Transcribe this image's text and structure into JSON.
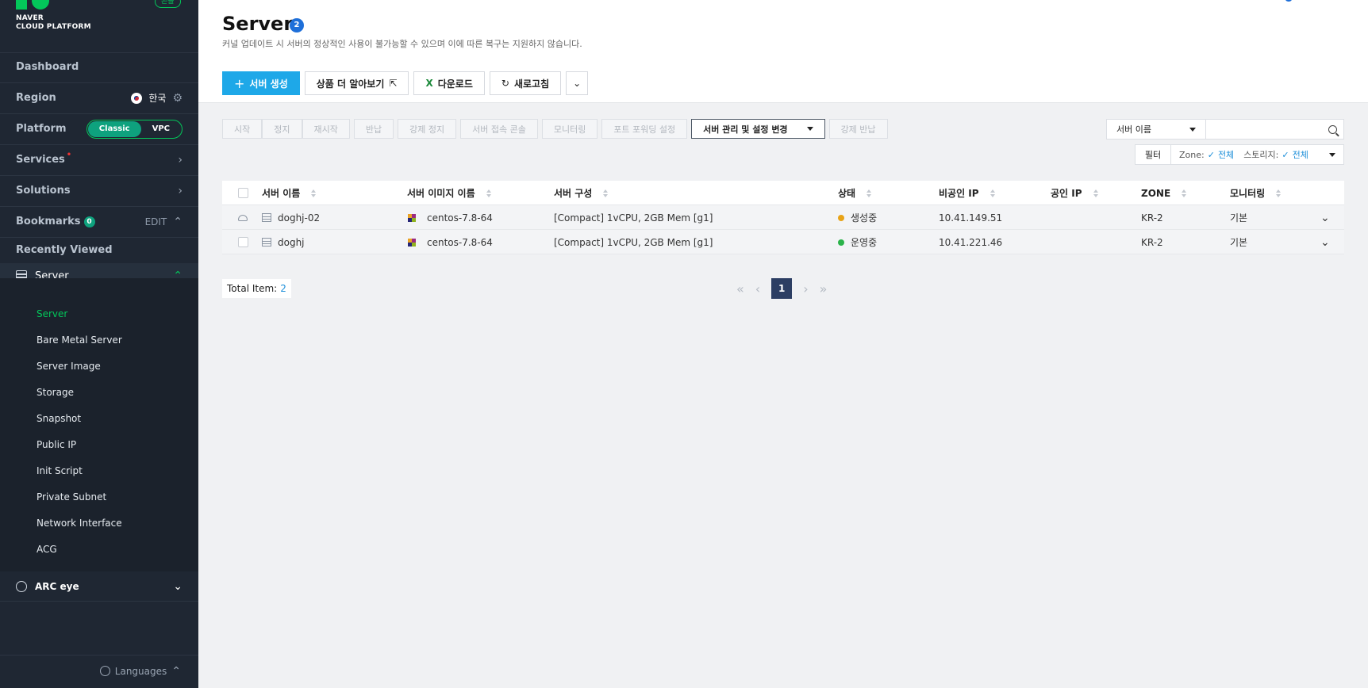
{
  "brand": {
    "name_line1": "NAVER",
    "name_line2": "CLOUD PLATFORM",
    "console_badge": "콘솔"
  },
  "sidebar": {
    "dashboard": "Dashboard",
    "region_label": "Region",
    "region_value": "한국",
    "platform_label": "Platform",
    "platform_options": [
      "Classic",
      "VPC"
    ],
    "platform_selected": "Classic",
    "services": "Services",
    "solutions": "Solutions",
    "bookmarks": "Bookmarks",
    "bookmarks_count": "0",
    "bookmarks_edit": "EDIT",
    "recently_viewed": "Recently Viewed",
    "server_group": "Server",
    "sub_items": [
      "Server",
      "Bare Metal Server",
      "Server Image",
      "Storage",
      "Snapshot",
      "Public IP",
      "Init Script",
      "Private Subnet",
      "Network Interface",
      "ACG"
    ],
    "active_sub_item": "Server",
    "arc_eye": "ARC eye",
    "languages": "Languages"
  },
  "page": {
    "title": "Server",
    "count_badge": "2",
    "subtitle": "커널 업데이트 시 서버의 정상적인 사용이 불가능할 수 있으며 이에 따른 복구는 지원하지 않습니다."
  },
  "actions": {
    "create": "서버 생성",
    "learn_more": "상품 더 알아보기",
    "download": "다운로드",
    "refresh": "새로고침"
  },
  "toolbar": {
    "buttons": [
      "시작",
      "정지",
      "재시작",
      "반납",
      "강제 정지",
      "서버 접속 콘솔",
      "모니터링",
      "포트 포워딩 설정"
    ],
    "manage": "서버 관리 및 설정 변경",
    "force_return": "강제 반납"
  },
  "search": {
    "field": "서버 이름",
    "value": ""
  },
  "filter": {
    "label": "필터",
    "zone_label": "Zone:",
    "zone_value": "전체",
    "storage_label": "스토리지:",
    "storage_value": "전체"
  },
  "table": {
    "columns": [
      "서버 이름",
      "서버 이미지 이름",
      "서버 구성",
      "상태",
      "비공인 IP",
      "공인 IP",
      "ZONE",
      "모니터링"
    ],
    "rows": [
      {
        "name": "doghj-02",
        "image": "centos-7.8-64",
        "spec": "[Compact] 1vCPU, 2GB Mem [g1]",
        "status": "생성중",
        "status_color": "#e8a317",
        "private_ip": "10.41.149.51",
        "public_ip": "",
        "zone": "KR-2",
        "monitoring": "기본"
      },
      {
        "name": "doghj",
        "image": "centos-7.8-64",
        "spec": "[Compact] 1vCPU, 2GB Mem [g1]",
        "status": "운영중",
        "status_color": "#2bb34a",
        "private_ip": "10.41.221.46",
        "public_ip": "",
        "zone": "KR-2",
        "monitoring": "기본"
      }
    ]
  },
  "footer": {
    "total_label": "Total Item:",
    "total_value": "2",
    "current_page": "1"
  },
  "colors": {
    "sidebar_bg": "#1f2733",
    "accent_green": "#03c75a",
    "primary_blue": "#1ea8e8",
    "pager_active": "#2c3e63"
  }
}
